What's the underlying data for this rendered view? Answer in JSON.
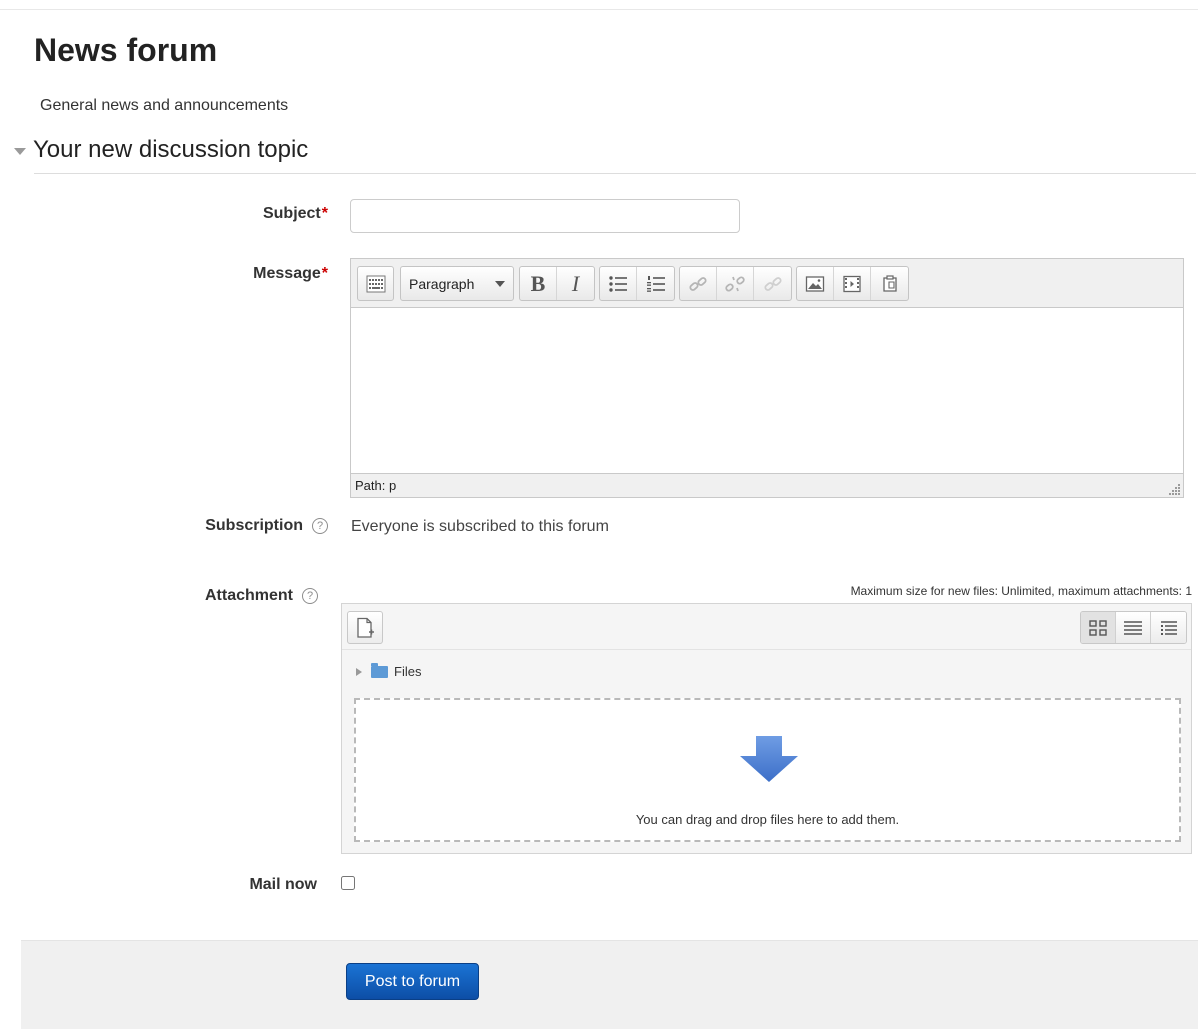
{
  "page": {
    "title": "News forum",
    "description": "General news and announcements"
  },
  "section": {
    "title": "Your new discussion topic"
  },
  "form": {
    "subject": {
      "label": "Subject",
      "required_mark": "*",
      "value": ""
    },
    "message": {
      "label": "Message",
      "required_mark": "*",
      "format_select": "Paragraph",
      "bold_glyph": "B",
      "italic_glyph": "I",
      "status_path": "Path: p",
      "toolbar_icons": [
        "toolbar-toggle-icon",
        "bullet-list-icon",
        "numbered-list-icon",
        "link-icon",
        "unlink-icon",
        "anchor-icon",
        "image-icon",
        "media-icon",
        "paste-icon"
      ]
    },
    "subscription": {
      "label": "Subscription",
      "help_glyph": "?",
      "text": "Everyone is subscribed to this forum"
    },
    "attachment": {
      "label": "Attachment",
      "help_glyph": "?",
      "max_size_text": "Maximum size for new files: Unlimited, maximum attachments: 1",
      "path_label": "Files",
      "drop_text": "You can drag and drop files here to add them.",
      "view_modes": [
        "icons-view-icon",
        "list-view-icon",
        "tree-view-icon"
      ]
    },
    "mail_now": {
      "label": "Mail now",
      "checked": false
    },
    "submit_label": "Post to forum"
  },
  "colors": {
    "required": "#cc0000",
    "primary_button": "#0d4ea6",
    "folder": "#5d9ad6",
    "drop_arrow": "#4a7fd4"
  }
}
